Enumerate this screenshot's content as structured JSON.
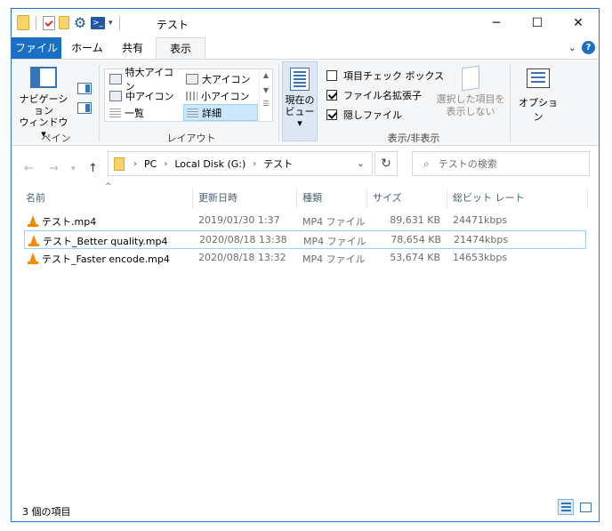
{
  "window": {
    "title": "テスト"
  },
  "tabs": {
    "file": "ファイル",
    "home": "ホーム",
    "share": "共有",
    "view": "表示"
  },
  "ribbon": {
    "nav_pane_label_line1": "ナビゲーション",
    "nav_pane_label_line2": "ウィンドウ",
    "pane_group": "ペイン",
    "layout_group": "レイアウト",
    "layouts": [
      {
        "label": "特大アイコン"
      },
      {
        "label": "大アイコン"
      },
      {
        "label": "中アイコン"
      },
      {
        "label": "小アイコン"
      },
      {
        "label": "一覧"
      },
      {
        "label": "詳細"
      }
    ],
    "selected_layout": "詳細",
    "current_view_line1": "現在の",
    "current_view_line2": "ビュー",
    "checkboxes": [
      {
        "label": "項目チェック ボックス",
        "checked": false
      },
      {
        "label": "ファイル名拡張子",
        "checked": true
      },
      {
        "label": "隠しファイル",
        "checked": true
      }
    ],
    "hide_selected_line1": "選択した項目を",
    "hide_selected_line2": "表示しない",
    "show_hide_group": "表示/非表示",
    "options": "オプション"
  },
  "address": {
    "crumbs": [
      "PC",
      "Local Disk (G:)",
      "テスト"
    ],
    "search_placeholder": "テストの検索"
  },
  "columns": [
    "名前",
    "更新日時",
    "種類",
    "サイズ",
    "総ビット レート"
  ],
  "files": [
    {
      "name": "テスト.mp4",
      "modified": "2019/01/30 1:37",
      "type": "MP4 ファイル",
      "size": "89,631 KB",
      "bitrate": "24471kbps",
      "selected": false
    },
    {
      "name": "テスト_Better quality.mp4",
      "modified": "2020/08/18 13:38",
      "type": "MP4 ファイル",
      "size": "78,654 KB",
      "bitrate": "21474kbps",
      "selected": true
    },
    {
      "name": "テスト_Faster encode.mp4",
      "modified": "2020/08/18 13:32",
      "type": "MP4 ファイル",
      "size": "53,674 KB",
      "bitrate": "14653kbps",
      "selected": false
    }
  ],
  "status": {
    "item_count": "3 個の項目"
  },
  "colors": {
    "accent": "#1a6fc4",
    "selection_border": "#99d1ff",
    "vlc_orange": "#f48a00"
  }
}
